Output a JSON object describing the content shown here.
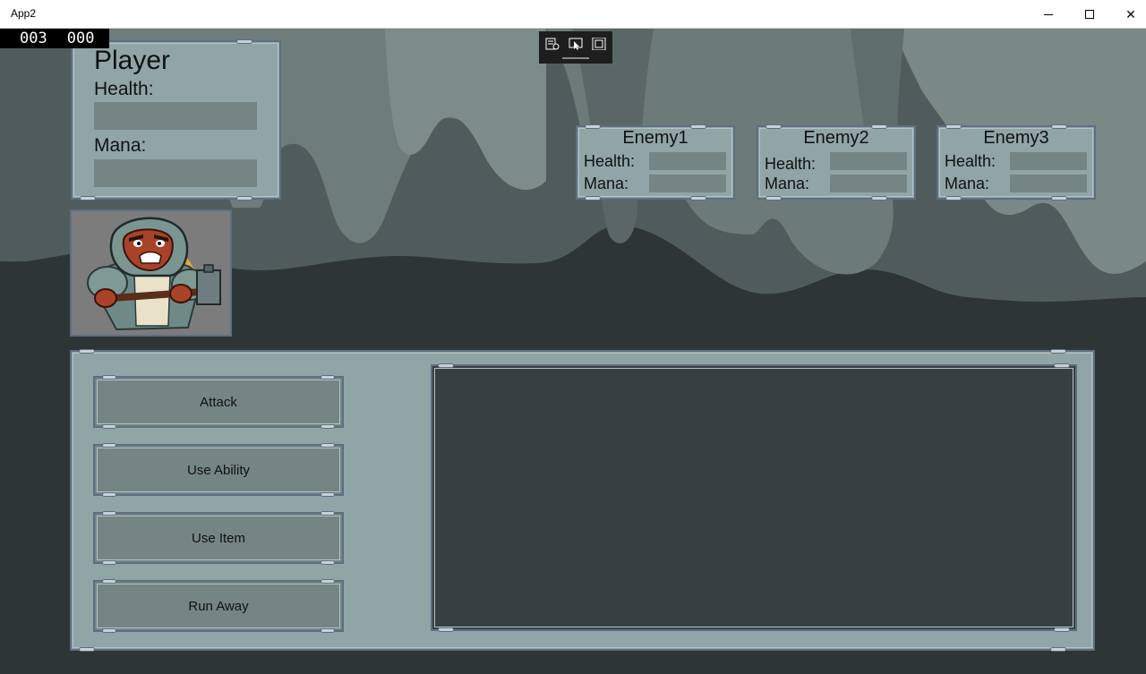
{
  "window": {
    "title": "App2"
  },
  "counter": {
    "left": "003",
    "right": "000"
  },
  "player": {
    "name": "Player",
    "health_label": "Health:",
    "mana_label": "Mana:"
  },
  "enemies": [
    {
      "name": "Enemy1",
      "health_label": "Health:",
      "mana_label": "Mana:"
    },
    {
      "name": "Enemy2",
      "health_label": "Health:",
      "mana_label": "Mana:"
    },
    {
      "name": "Enemy3",
      "health_label": "Health:",
      "mana_label": "Mana:"
    }
  ],
  "actions": {
    "attack": "Attack",
    "use_ability": "Use Ability",
    "use_item": "Use Item",
    "run_away": "Run Away"
  },
  "colors": {
    "panel": "#91a5a6",
    "bar": "#748584",
    "background": "#2d3535",
    "log": "#374041",
    "border": "#5e6e83"
  }
}
